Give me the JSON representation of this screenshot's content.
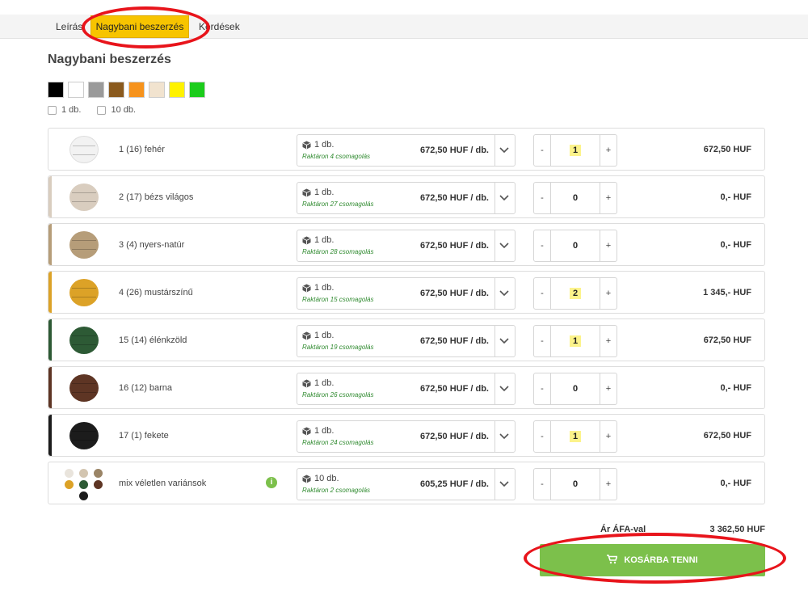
{
  "tabs": [
    {
      "label": "Leírás"
    },
    {
      "label": "Nagybani beszerzés"
    },
    {
      "label": "Kérdések"
    }
  ],
  "section_title": "Nagybani beszerzés",
  "colors": {
    "active_tab": "#f7c400",
    "cart_button": "#7cc04b",
    "stock_text": "#2f8a2f",
    "highlight_qty": "#fcf38b",
    "annotation": "#e8141b"
  },
  "swatches": [
    "#000000",
    "#ffffff",
    "#9a9a9a",
    "#8a5a1e",
    "#f6931d",
    "#f1e3cf",
    "#fff200",
    "#1ccc1c"
  ],
  "package_filters": [
    {
      "label": "1 db."
    },
    {
      "label": "10 db."
    }
  ],
  "products": [
    {
      "name": "1 (16) fehér",
      "color": "#f2f2f2",
      "pack_qty": "1 db.",
      "stock": "Raktáron 4 csomagolás",
      "price": "672,50 HUF / db.",
      "qty": "1",
      "total": "672,50 HUF"
    },
    {
      "name": "2 (17) bézs világos",
      "color": "#d9cdbf",
      "pack_qty": "1 db.",
      "stock": "Raktáron 27 csomagolás",
      "price": "672,50 HUF / db.",
      "qty": "0",
      "total": "0,- HUF"
    },
    {
      "name": "3 (4) nyers-natúr",
      "color": "#b69d79",
      "pack_qty": "1 db.",
      "stock": "Raktáron 28 csomagolás",
      "price": "672,50 HUF / db.",
      "qty": "0",
      "total": "0,- HUF"
    },
    {
      "name": "4 (26) mustárszínű",
      "color": "#dca227",
      "pack_qty": "1 db.",
      "stock": "Raktáron 15 csomagolás",
      "price": "672,50 HUF / db.",
      "qty": "2",
      "total": "1 345,- HUF"
    },
    {
      "name": "15 (14) élénkzöld",
      "color": "#2d5a35",
      "pack_qty": "1 db.",
      "stock": "Raktáron 19 csomagolás",
      "price": "672,50 HUF / db.",
      "qty": "1",
      "total": "672,50 HUF"
    },
    {
      "name": "16 (12) barna",
      "color": "#5e3524",
      "pack_qty": "1 db.",
      "stock": "Raktáron 26 csomagolás",
      "price": "672,50 HUF / db.",
      "qty": "0",
      "total": "0,- HUF"
    },
    {
      "name": "17 (1) fekete",
      "color": "#1c1c1c",
      "pack_qty": "1 db.",
      "stock": "Raktáron 24 csomagolás",
      "price": "672,50 HUF / db.",
      "qty": "1",
      "total": "672,50 HUF"
    },
    {
      "name": "mix véletlen variánsok",
      "color": "",
      "pack_qty": "10 db.",
      "stock": "Raktáron 2 csomagolás",
      "price": "605,25 HUF / db.",
      "qty": "0",
      "total": "0,- HUF"
    }
  ],
  "mix_colors": [
    "#e9e4dc",
    "#d3c5b0",
    "#9a8466",
    "#dca227",
    "#2d5a35",
    "#5e3524",
    "#1c1c1c"
  ],
  "icons": {
    "package": "package-icon",
    "dropdown": "chevron-down-icon",
    "info": "info-icon",
    "cart": "cart-icon"
  },
  "stepper": {
    "minus": "-",
    "plus": "+"
  },
  "info_symbol": "i",
  "summary": {
    "label": "Ár ÁFA-val",
    "value": "3 362,50 HUF"
  },
  "cart_button": {
    "label": "KOSÁRBA TENNI"
  }
}
